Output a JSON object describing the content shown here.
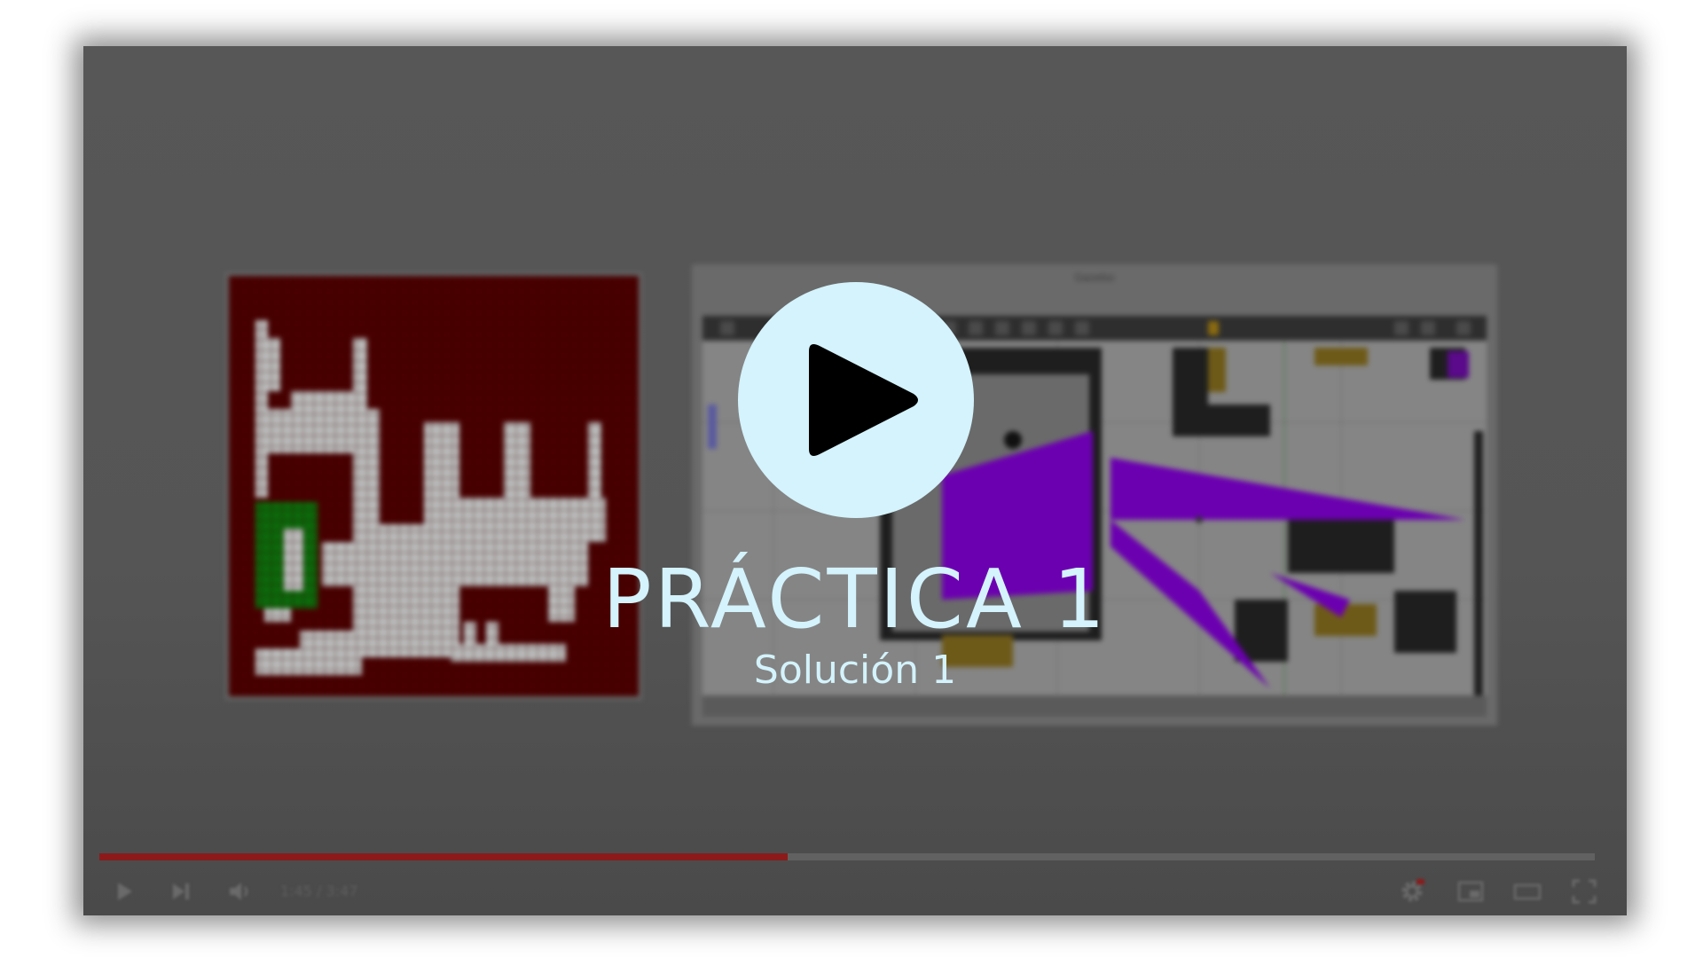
{
  "video": {
    "title": "PRÁCTICA 1",
    "subtitle": "Solución 1",
    "progress_fraction": 0.46,
    "time_display": "1:45 / 3:47",
    "sim_window_title": "Gazebo"
  },
  "colors": {
    "play_button": "#d4f3fc",
    "title_text": "#d4f3fc",
    "progress": "#8c1a1a",
    "map_wall": "#4a0000",
    "map_free": "#bdbdbd",
    "map_goal": "#0b6b0b",
    "laser": "#6b00b0"
  },
  "controls": {
    "play": "play-icon",
    "next": "next-icon",
    "volume": "volume-icon",
    "settings": "gear-icon",
    "miniplayer": "miniplayer-icon",
    "theater": "theater-icon",
    "fullscreen": "fullscreen-icon"
  }
}
